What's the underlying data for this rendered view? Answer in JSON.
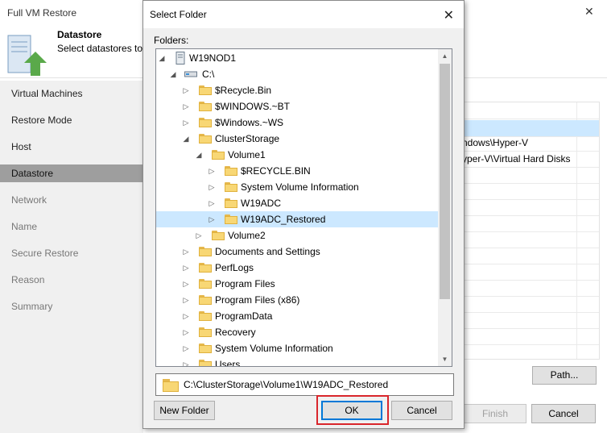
{
  "wizard": {
    "title": "Full VM Restore",
    "header_title": "Datastore",
    "header_subtitle": "Select datastores to",
    "nav": [
      "Virtual Machines",
      "Restore Mode",
      "Host",
      "Datastore",
      "Network",
      "Name",
      "Secure Restore",
      "Reason",
      "Summary"
    ],
    "grid_rows": [
      "",
      "",
      "ndows\\Hyper-V",
      "yper-V\\Virtual Hard Disks",
      "",
      "",
      "",
      "",
      "",
      "",
      "",
      "",
      "",
      "",
      "",
      ""
    ],
    "path_button": "Path...",
    "finish_button": "Finish",
    "cancel_button": "Cancel"
  },
  "dialog": {
    "title": "Select Folder",
    "folders_label": "Folders:",
    "tree": [
      {
        "label": "W19NOD1",
        "icon": "computer-icon",
        "arrow": "expanded"
      },
      {
        "label": "C:\\",
        "icon": "drive-icon",
        "arrow": "expanded"
      },
      {
        "label": "$Recycle.Bin",
        "icon": "folder-icon",
        "arrow": "collapsed"
      },
      {
        "label": "$WINDOWS.~BT",
        "icon": "folder-icon",
        "arrow": "collapsed"
      },
      {
        "label": "$Windows.~WS",
        "icon": "folder-icon",
        "arrow": "collapsed"
      },
      {
        "label": "ClusterStorage",
        "icon": "folder-icon",
        "arrow": "expanded"
      },
      {
        "label": "Volume1",
        "icon": "folder-icon",
        "arrow": "expanded"
      },
      {
        "label": "$RECYCLE.BIN",
        "icon": "folder-icon",
        "arrow": "collapsed"
      },
      {
        "label": "System Volume Information",
        "icon": "folder-icon",
        "arrow": "collapsed"
      },
      {
        "label": "W19ADC",
        "icon": "folder-icon",
        "arrow": "collapsed"
      },
      {
        "label": "W19ADC_Restored",
        "icon": "folder-icon",
        "arrow": "collapsed",
        "selected": true
      },
      {
        "label": "Volume2",
        "icon": "folder-icon",
        "arrow": "collapsed"
      },
      {
        "label": "Documents and Settings",
        "icon": "folder-icon",
        "arrow": "collapsed"
      },
      {
        "label": "PerfLogs",
        "icon": "folder-icon",
        "arrow": "collapsed"
      },
      {
        "label": "Program Files",
        "icon": "folder-icon",
        "arrow": "collapsed"
      },
      {
        "label": "Program Files (x86)",
        "icon": "folder-icon",
        "arrow": "collapsed"
      },
      {
        "label": "ProgramData",
        "icon": "folder-icon",
        "arrow": "collapsed"
      },
      {
        "label": "Recovery",
        "icon": "folder-icon",
        "arrow": "collapsed"
      },
      {
        "label": "System Volume Information",
        "icon": "folder-icon",
        "arrow": "collapsed"
      },
      {
        "label": "Users",
        "icon": "folder-icon",
        "arrow": "collapsed"
      }
    ],
    "path_value": "C:\\ClusterStorage\\Volume1\\W19ADC_Restored",
    "new_folder_button": "New Folder",
    "ok_button": "OK",
    "cancel_button": "Cancel"
  },
  "colors": {
    "selection": "#cce8ff",
    "highlight_box": "#d9262c",
    "accent": "#0078d7"
  }
}
